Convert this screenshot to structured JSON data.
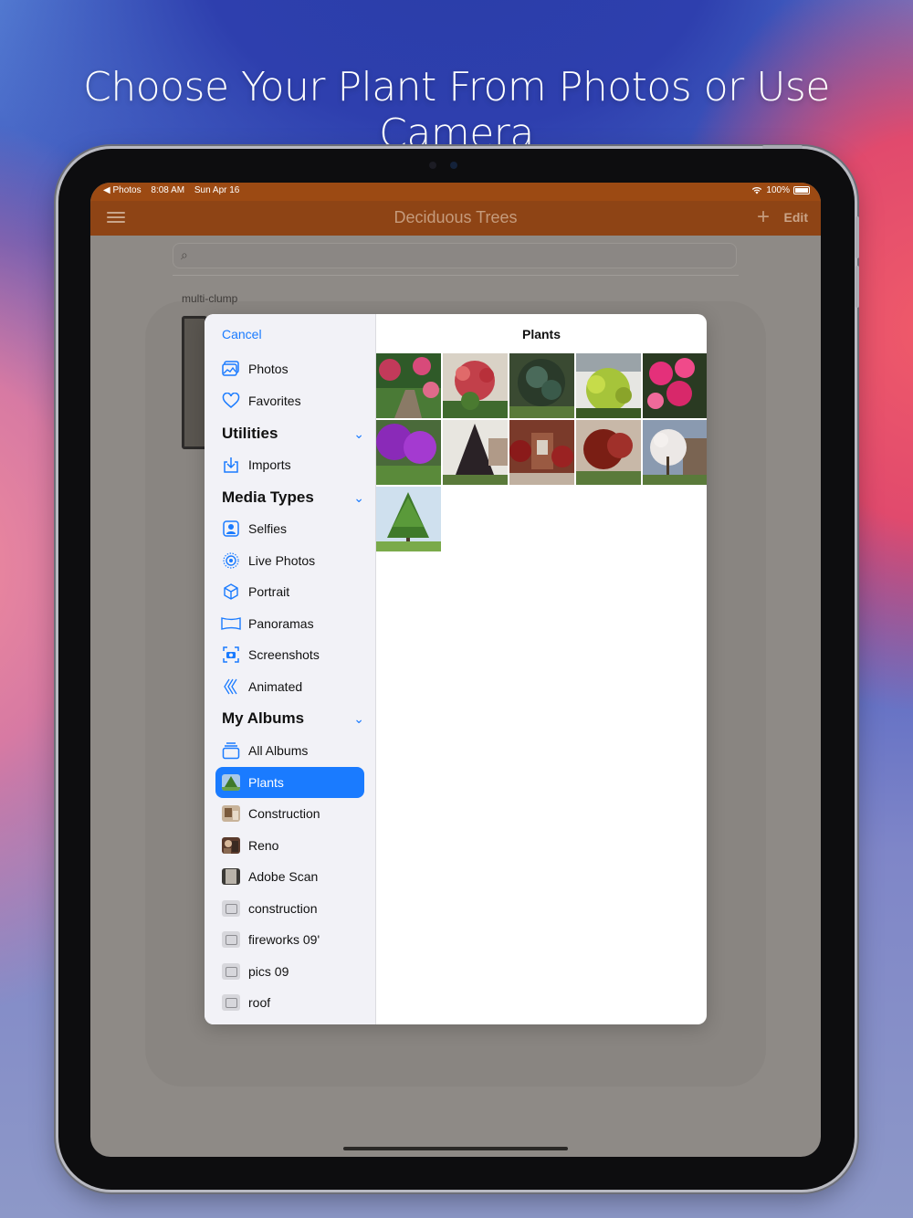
{
  "headline": "Choose Your Plant From Photos or Use Camera",
  "status": {
    "back_app": "◀ Photos",
    "time": "8:08 AM",
    "date": "Sun Apr 16",
    "battery": "100%"
  },
  "nav": {
    "title": "Deciduous Trees",
    "edit": "Edit"
  },
  "background_list": {
    "section": "multi-clump"
  },
  "picker": {
    "cancel": "Cancel",
    "title": "Plants",
    "items_top": [
      {
        "label": "Photos",
        "icon": "photos-icon"
      },
      {
        "label": "Favorites",
        "icon": "heart-icon"
      }
    ],
    "utilities_header": "Utilities",
    "utilities": [
      {
        "label": "Imports",
        "icon": "import-icon"
      }
    ],
    "media_types_header": "Media Types",
    "media_types": [
      {
        "label": "Selfies",
        "icon": "selfie-icon"
      },
      {
        "label": "Live Photos",
        "icon": "live-photo-icon"
      },
      {
        "label": "Portrait",
        "icon": "portrait-cube-icon"
      },
      {
        "label": "Panoramas",
        "icon": "panorama-icon"
      },
      {
        "label": "Screenshots",
        "icon": "screenshot-icon"
      },
      {
        "label": "Animated",
        "icon": "animated-icon"
      }
    ],
    "my_albums_header": "My Albums",
    "albums": [
      {
        "label": "All Albums",
        "icon": "albums-stack-icon"
      },
      {
        "label": "Plants",
        "icon": "plants-thumb",
        "selected": true
      },
      {
        "label": "Construction",
        "icon": "construction-thumb"
      },
      {
        "label": "Reno",
        "icon": "reno-thumb"
      },
      {
        "label": "Adobe Scan",
        "icon": "adobe-scan-thumb"
      },
      {
        "label": "construction",
        "icon": "generic-album-icon"
      },
      {
        "label": "fireworks 09'",
        "icon": "generic-album-icon"
      },
      {
        "label": "pics 09",
        "icon": "generic-album-icon"
      },
      {
        "label": "roof",
        "icon": "generic-album-icon"
      }
    ],
    "photos": [
      "garden-path-photo",
      "red-shrub-photo",
      "blue-spruce-photo",
      "golden-shrub-photo",
      "pink-azalea-photo",
      "purple-azalea-photo",
      "dark-tree-photo",
      "red-maple-house-photo",
      "red-maple-photo",
      "magnolia-photo",
      "green-tree-photo"
    ]
  },
  "colors": {
    "accent": "#1a7bff",
    "navbar": "#8e4415",
    "statusbar": "#9c4a13"
  }
}
